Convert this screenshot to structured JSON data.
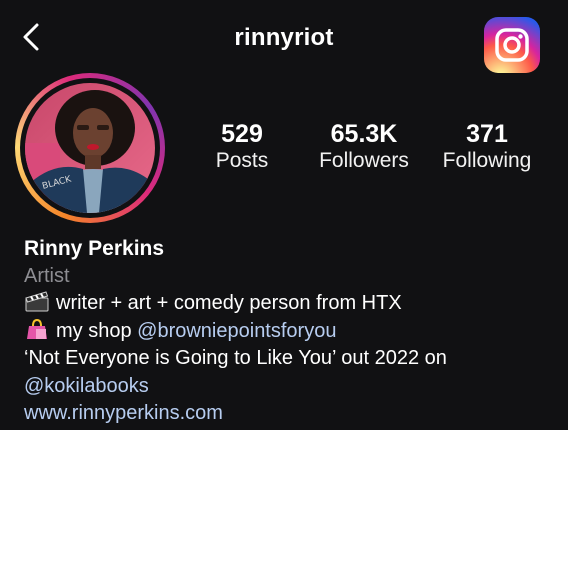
{
  "header": {
    "username": "rinnyriot",
    "back_icon": "chevron-left-icon",
    "logo_icon": "instagram-logo-icon"
  },
  "stats": {
    "posts_value": "529",
    "posts_label": "Posts",
    "followers_value": "65.3K",
    "followers_label": "Followers",
    "following_value": "371",
    "following_label": "Following"
  },
  "bio": {
    "name": "Rinny Perkins",
    "category": "Artist",
    "line1_text": "writer + art + comedy person from HTX",
    "line1_icon": "clapper-board-icon",
    "line2_prefix": "my shop ",
    "line2_mention": "@browniepointsforyou",
    "line2_icon": "shopping-bags-icon",
    "line3_text": "‘Not Everyone is Going to Like You’ out 2022 on",
    "line4_mention": "@kokilabooks",
    "website": "www.rinnyperkins.com"
  },
  "colors": {
    "panel_background": "#111113",
    "link_color": "#b7cdf0",
    "category_color": "#8e8e93"
  }
}
